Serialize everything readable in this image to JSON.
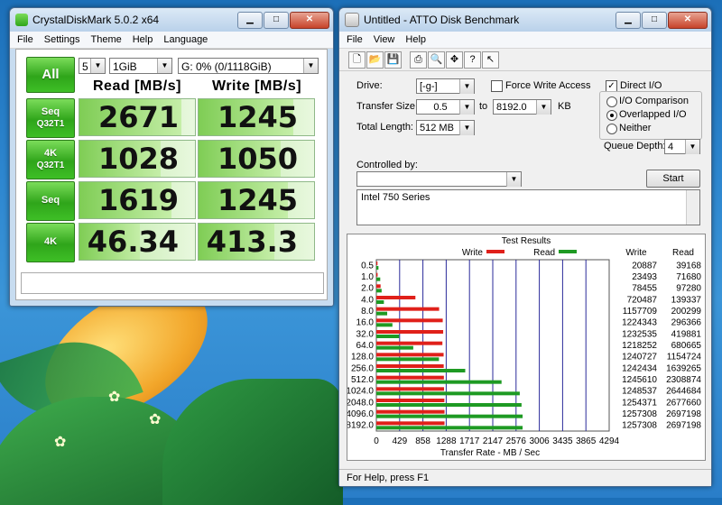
{
  "colors": {
    "write": "#e0201a",
    "read": "#1e9a23",
    "grid": "#2a2a9a",
    "green_button": "#3ebf26"
  },
  "cdm": {
    "title": "CrystalDiskMark 5.0.2 x64",
    "menu": [
      "File",
      "Settings",
      "Theme",
      "Help",
      "Language"
    ],
    "all_label": "All",
    "count": "5",
    "size": "1GiB",
    "drive": "G: 0% (0/1118GiB)",
    "read_header": "Read [MB/s]",
    "write_header": "Write [MB/s]",
    "rows": [
      {
        "line1": "Seq",
        "line2": "Q32T1",
        "read": "2671",
        "write": "1245",
        "read_fill": 0.88,
        "write_fill": 0.82
      },
      {
        "line1": "4K",
        "line2": "Q32T1",
        "read": "1028",
        "write": "1050",
        "read_fill": 0.7,
        "write_fill": 0.71
      },
      {
        "line1": "Seq",
        "line2": "",
        "read": "1619",
        "write": "1245",
        "read_fill": 0.8,
        "write_fill": 0.77
      },
      {
        "line1": "4K",
        "line2": "",
        "read": "46.34",
        "write": "413.3",
        "read_fill": 0.52,
        "write_fill": 0.66
      }
    ]
  },
  "atto": {
    "title": "Untitled - ATTO Disk Benchmark",
    "menu": [
      "File",
      "View",
      "Help"
    ],
    "toolbar_icons": [
      "new-icon",
      "open-icon",
      "save-icon",
      "print-icon",
      "print-preview-icon",
      "move-icon",
      "help-icon",
      "context-help-icon"
    ],
    "drive_label": "Drive:",
    "drive_value": "[-g-]",
    "force_write_label": "Force Write Access",
    "direct_io_label": "Direct I/O",
    "transfer_label": "Transfer Size:",
    "transfer_from": "0.5",
    "transfer_to_word": "to",
    "transfer_to": "8192.0",
    "transfer_unit": "KB",
    "total_length_label": "Total Length:",
    "total_length_value": "512 MB",
    "io_comparison": "I/O Comparison",
    "overlapped_io": "Overlapped I/O",
    "neither": "Neither",
    "queue_depth_label": "Queue Depth:",
    "queue_depth_value": "4",
    "controlled_by_label": "Controlled by:",
    "start_label": "Start",
    "description": "Intel 750 Series",
    "results_title": "Test Results",
    "legend_write": "Write",
    "legend_read": "Read",
    "col_write": "Write",
    "col_read": "Read",
    "xaxis_label": "Transfer Rate - MB / Sec",
    "status": "For Help, press F1"
  },
  "chart_data": {
    "type": "bar",
    "title": "Test Results",
    "xlabel": "Transfer Rate - MB / Sec",
    "ylabel": "",
    "xlim": [
      0,
      4294
    ],
    "xticks": [
      "0",
      "429",
      "858",
      "1288",
      "1717",
      "2147",
      "2576",
      "3006",
      "3435",
      "3865",
      "4294"
    ],
    "categories": [
      "0.5",
      "1.0",
      "2.0",
      "4.0",
      "8.0",
      "16.0",
      "32.0",
      "64.0",
      "128.0",
      "256.0",
      "512.0",
      "1024.0",
      "2048.0",
      "4096.0",
      "8192.0"
    ],
    "series": [
      {
        "name": "Write",
        "values": [
          20.887,
          23.493,
          78.455,
          720.487,
          1157.709,
          1224.343,
          1232.535,
          1218.252,
          1240.727,
          1242.434,
          1245.61,
          1248.537,
          1254.371,
          1257.308,
          1257.308
        ],
        "raw": [
          "20887",
          "23493",
          "78455",
          "720487",
          "1157709",
          "1224343",
          "1232535",
          "1218252",
          "1240727",
          "1242434",
          "1245610",
          "1248537",
          "1254371",
          "1257308",
          "1257308"
        ]
      },
      {
        "name": "Read",
        "values": [
          39.168,
          71.68,
          97.28,
          139.337,
          200.299,
          296.366,
          419.881,
          680.665,
          1154.724,
          1639.265,
          2308.874,
          2644.684,
          2677.66,
          2697.198,
          2697.198
        ],
        "raw": [
          "39168",
          "71680",
          "97280",
          "139337",
          "200299",
          "296366",
          "419881",
          "680665",
          "1154724",
          "1639265",
          "2308874",
          "2644684",
          "2677660",
          "2697198",
          "2697198"
        ]
      }
    ],
    "grid": true,
    "legend": "top"
  }
}
